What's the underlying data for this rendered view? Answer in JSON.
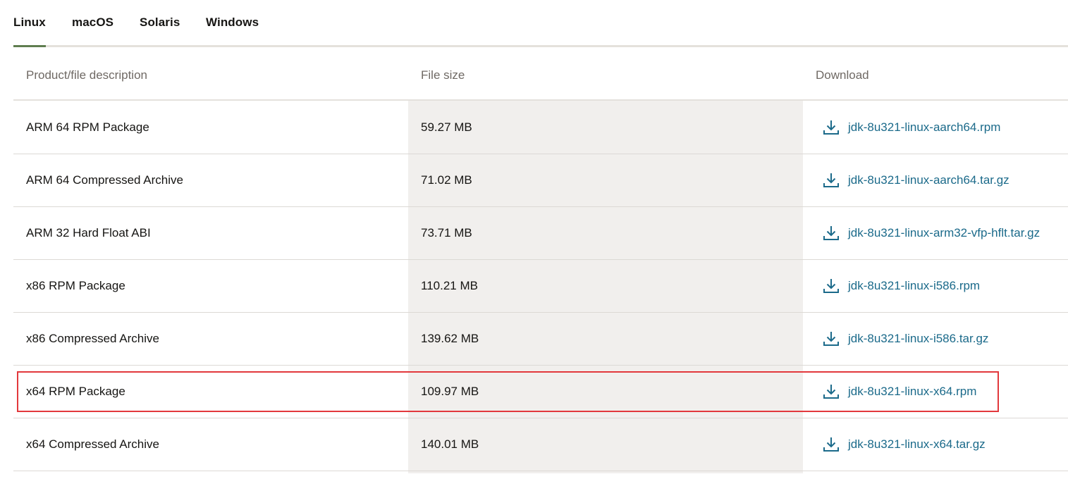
{
  "tabs": [
    {
      "label": "Linux",
      "active": true
    },
    {
      "label": "macOS",
      "active": false
    },
    {
      "label": "Solaris",
      "active": false
    },
    {
      "label": "Windows",
      "active": false
    }
  ],
  "table": {
    "headers": {
      "description": "Product/file description",
      "size": "File size",
      "download": "Download"
    },
    "rows": [
      {
        "description": "ARM 64 RPM Package",
        "size": "59.27 MB",
        "file": "jdk-8u321-linux-aarch64.rpm"
      },
      {
        "description": "ARM 64 Compressed Archive",
        "size": "71.02 MB",
        "file": "jdk-8u321-linux-aarch64.tar.gz"
      },
      {
        "description": "ARM 32 Hard Float ABI",
        "size": "73.71 MB",
        "file": "jdk-8u321-linux-arm32-vfp-hflt.tar.gz"
      },
      {
        "description": "x86 RPM Package",
        "size": "110.21 MB",
        "file": "jdk-8u321-linux-i586.rpm"
      },
      {
        "description": "x86 Compressed Archive",
        "size": "139.62 MB",
        "file": "jdk-8u321-linux-i586.tar.gz"
      },
      {
        "description": "x64 RPM Package",
        "size": "109.97 MB",
        "file": "jdk-8u321-linux-x64.rpm",
        "highlighted": true
      },
      {
        "description": "x64 Compressed Archive",
        "size": "140.01 MB",
        "file": "jdk-8u321-linux-x64.tar.gz"
      }
    ]
  },
  "icons": {
    "download": "download-icon"
  },
  "colors": {
    "active_tab_underline": "#5f7d4f",
    "link": "#1b6a8a",
    "highlight_border": "#e2383c",
    "size_column_bg": "#f1efed"
  }
}
